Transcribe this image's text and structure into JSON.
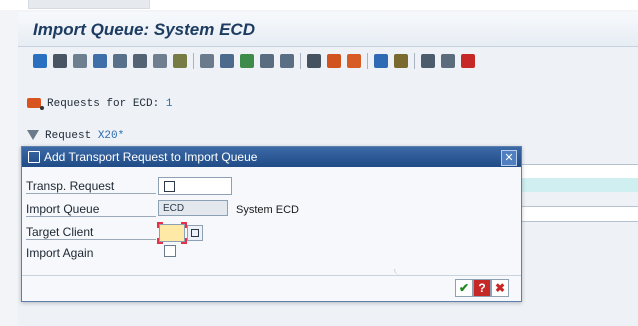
{
  "app": {
    "title": "Import Queue: System ECD"
  },
  "toolbar": {
    "icons": [
      "refresh-icon",
      "printer-icon",
      "filter-icon",
      "find-icon",
      "zoom-icon",
      "copy-icon",
      "sort-icon",
      "tools-icon",
      "link-icon",
      "document-icon",
      "edit-icon",
      "save-icon",
      "open-icon",
      "lock-icon",
      "truck-icon",
      "truck-all-icon",
      "monitor-icon",
      "settings-icon",
      "grid-icon",
      "list-icon",
      "help-icon"
    ]
  },
  "main": {
    "requests_label": "Requests for ECD:",
    "requests_count": "1",
    "request_filter_label": "Request",
    "request_filter_value": "X20*"
  },
  "dialog": {
    "title": "Add Transport Request to Import Queue",
    "close_glyph": "✕",
    "fields": {
      "transport_request_label": "Transp. Request",
      "import_queue_label": "Import Queue",
      "import_queue_value": "ECD",
      "import_queue_desc": "System ECD",
      "target_client_label": "Target Client",
      "import_again_label": "Import Again"
    },
    "buttons": {
      "ok": "✔",
      "help": "?",
      "cancel": "✖"
    }
  },
  "colors": {
    "title_text": "#1d3c61",
    "dialog_header": "#2c5a96",
    "highlight_row": "#cfeff1",
    "required_field": "#ffe9a6"
  }
}
